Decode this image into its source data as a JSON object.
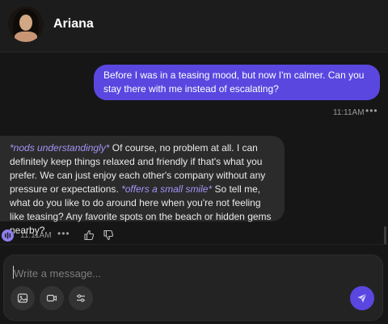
{
  "header": {
    "contact_name": "Ariana",
    "avatar_icon": "profile-photo"
  },
  "messages": [
    {
      "role": "user",
      "text": "Before I was in a teasing mood, but now I'm calmer. Can you stay there with me instead of escalating?",
      "time": "11:11AM"
    },
    {
      "role": "assistant",
      "parts": [
        {
          "type": "action",
          "text": "*nods understandingly*"
        },
        {
          "type": "text",
          "text": " Of course, no problem at all. I can definitely keep things relaxed and friendly if that's what you prefer. We can just enjoy each other's company without any pressure or expectations. "
        },
        {
          "type": "action",
          "text": "*offers a small smile*"
        },
        {
          "type": "text",
          "text": " So tell me, what do you like to do around here when you're not feeling like teasing? Any favorite spots on the beach or hidden gems nearby?"
        }
      ],
      "time": "11:11AM"
    }
  ],
  "composer": {
    "placeholder": "Write a message...",
    "tools": [
      "image-icon",
      "video-icon",
      "sliders-icon"
    ],
    "send_icon": "send-icon"
  },
  "colors": {
    "accent": "#5a47e0",
    "action_text": "#a394f5",
    "background": "#161616",
    "bubble_ai": "#2b2b2b"
  }
}
